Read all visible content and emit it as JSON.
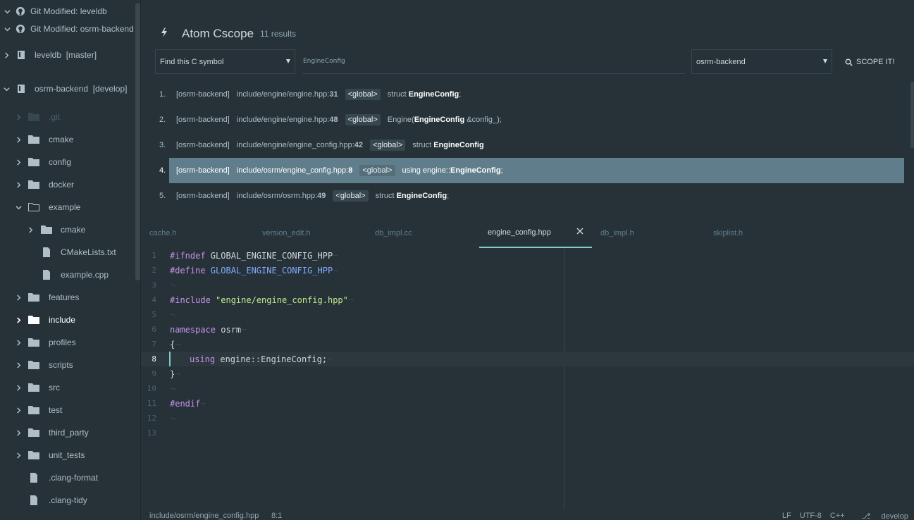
{
  "sidebar": {
    "git_rows": [
      {
        "label": "Git Modified: leveldb"
      },
      {
        "label": "Git Modified: osrm-backend"
      }
    ],
    "projects": [
      {
        "label": "leveldb",
        "branch": "[master]"
      },
      {
        "label": "osrm-backend",
        "branch": "[develop]"
      }
    ],
    "items": [
      {
        "label": ".git"
      },
      {
        "label": "cmake"
      },
      {
        "label": "config"
      },
      {
        "label": "docker"
      },
      {
        "label": "example"
      },
      {
        "label": "cmake"
      },
      {
        "label": "CMakeLists.txt"
      },
      {
        "label": "example.cpp"
      },
      {
        "label": "features"
      },
      {
        "label": "include"
      },
      {
        "label": "profiles"
      },
      {
        "label": "scripts"
      },
      {
        "label": "src"
      },
      {
        "label": "test"
      },
      {
        "label": "third_party"
      },
      {
        "label": "unit_tests"
      },
      {
        "label": ".clang-format"
      },
      {
        "label": ".clang-tidy"
      }
    ]
  },
  "cscope": {
    "title": "Atom Cscope",
    "count": "11 results",
    "mode_select": "Find this C symbol",
    "query_value": "EngineConfig",
    "project_select": "osrm-backend",
    "scope_button": "SCOPE IT!",
    "results": [
      {
        "num": "1.",
        "project": "[osrm-backend]",
        "file": "include/engine/engine.hpp:",
        "line": "31",
        "scope": "<global>",
        "pre": "struct ",
        "sym": "EngineConfig",
        "post": ";"
      },
      {
        "num": "2.",
        "project": "[osrm-backend]",
        "file": "include/engine/engine.hpp:",
        "line": "48",
        "scope": "<global>",
        "pre": "Engine(",
        "sym": "EngineConfig",
        "post": " &config_);"
      },
      {
        "num": "3.",
        "project": "[osrm-backend]",
        "file": "include/engine/engine_config.hpp:",
        "line": "42",
        "scope": "<global>",
        "pre": "struct ",
        "sym": "EngineConfig",
        "post": ""
      },
      {
        "num": "4.",
        "project": "[osrm-backend]",
        "file": "include/osrm/engine_config.hpp:",
        "line": "8",
        "scope": "<global>",
        "pre": "using engine::",
        "sym": "EngineConfig",
        "post": ";"
      },
      {
        "num": "5.",
        "project": "[osrm-backend]",
        "file": "include/osrm/osrm.hpp:",
        "line": "49",
        "scope": "<global>",
        "pre": "struct ",
        "sym": "EngineConfig",
        "post": ";"
      }
    ]
  },
  "tabs": [
    {
      "label": "cache.h"
    },
    {
      "label": "version_edit.h"
    },
    {
      "label": "db_impl.cc"
    },
    {
      "label": "engine_config.hpp"
    },
    {
      "label": "db_impl.h"
    },
    {
      "label": "skiplist.h"
    }
  ],
  "editor": {
    "line_numbers": [
      "1",
      "2",
      "3",
      "4",
      "5",
      "6",
      "7",
      "8",
      "9",
      "10",
      "11",
      "12",
      "13"
    ],
    "l1_kw": "#ifndef",
    "l1_rest": " GLOBAL_ENGINE_CONFIG_HPP",
    "l2_kw": "#define",
    "l2_rest": " GLOBAL_ENGINE_CONFIG_HPP",
    "l4_kw": "#include",
    "l4_str": " \"engine/engine_config.hpp\"",
    "l6_kw": "namespace",
    "l6_rest": " osrm",
    "l7": "{",
    "l8_kw": "using",
    "l8_rest": " engine::EngineConfig;",
    "l9": "}",
    "l11_kw": "#endif",
    "eol": "¬"
  },
  "status": {
    "path": "include/osrm/engine_config.hpp",
    "position": "8:1",
    "eol": "LF",
    "encoding": "UTF-8",
    "grammar": "C++",
    "branch": "develop"
  }
}
